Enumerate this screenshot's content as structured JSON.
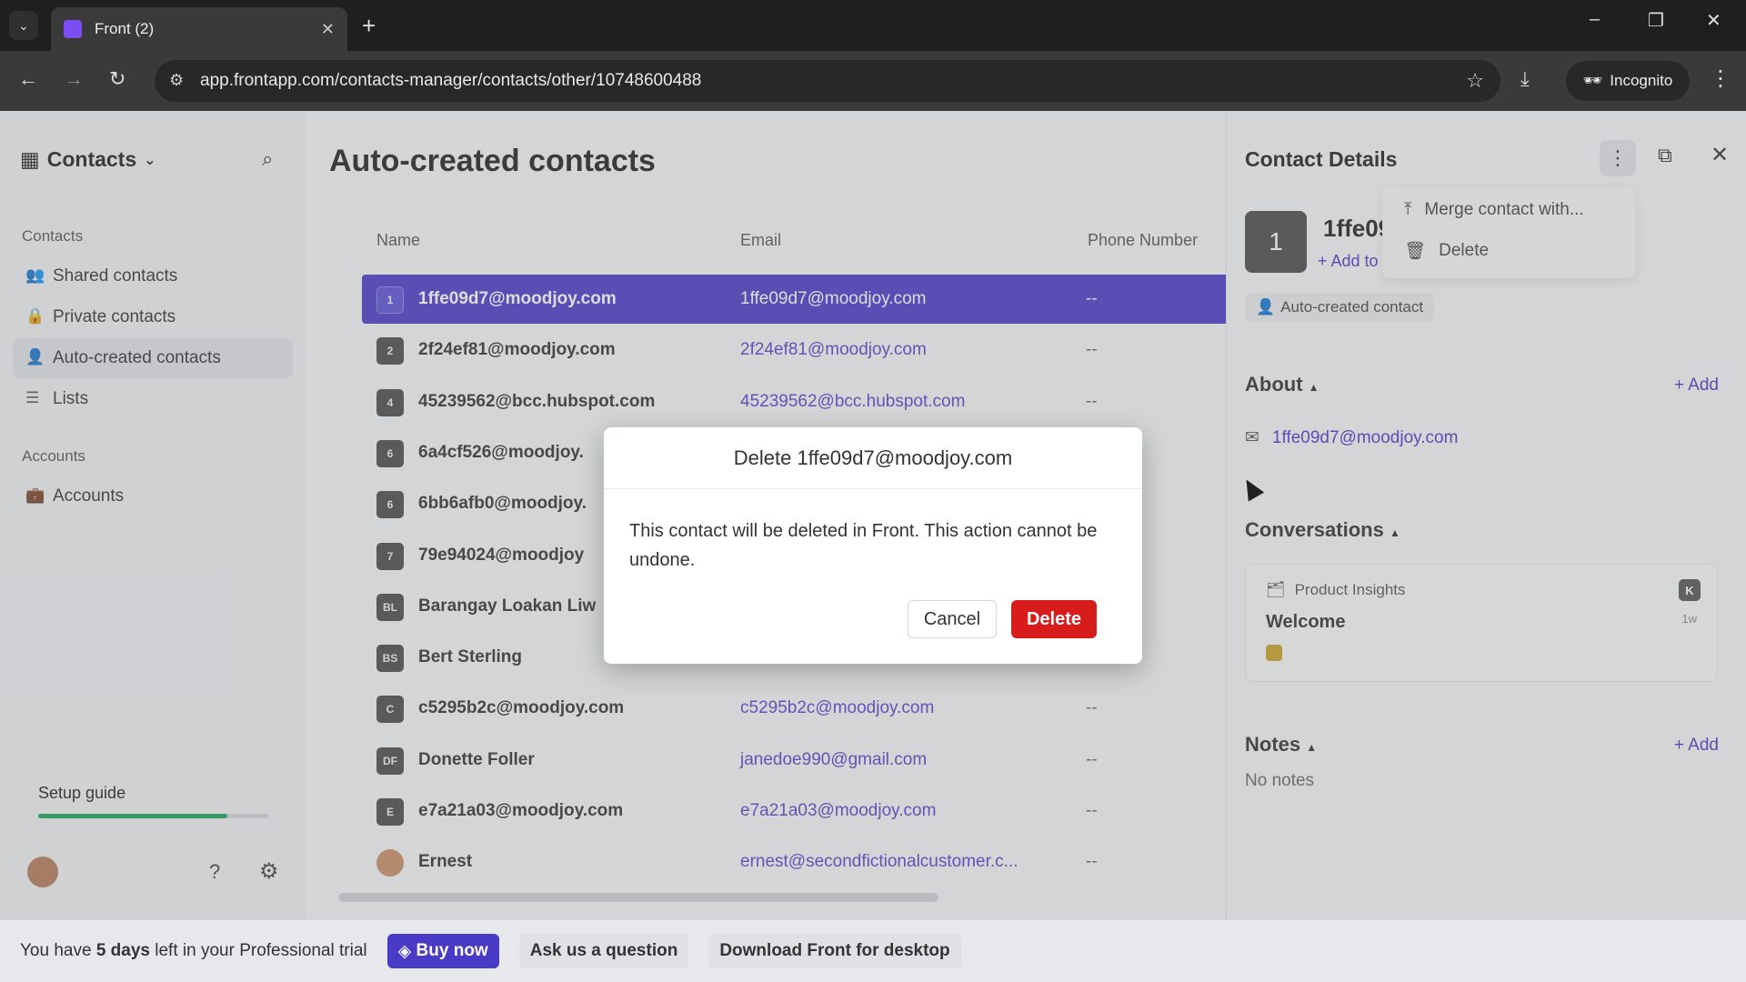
{
  "browser": {
    "tab_title": "Front (2)",
    "url": "app.frontapp.com/contacts-manager/contacts/other/10748600488",
    "incognito_label": "Incognito"
  },
  "sidebar": {
    "title": "Contacts",
    "section_contacts": "Contacts",
    "items": [
      {
        "label": "Shared contacts",
        "icon": "people-icon"
      },
      {
        "label": "Private contacts",
        "icon": "lock-icon"
      },
      {
        "label": "Auto-created contacts",
        "icon": "person-auto-icon"
      },
      {
        "label": "Lists",
        "icon": "list-icon"
      }
    ],
    "section_accounts": "Accounts",
    "accounts_item": "Accounts",
    "setup_guide": "Setup guide",
    "setup_progress": 0.82
  },
  "main": {
    "title": "Auto-created contacts",
    "columns": [
      "Name",
      "Email",
      "Phone Number"
    ],
    "rows": [
      {
        "avatar": "1",
        "name": "1ffe09d7@moodjoy.com",
        "email": "1ffe09d7@moodjoy.com",
        "phone": "--",
        "selected": true
      },
      {
        "avatar": "2",
        "name": "2f24ef81@moodjoy.com",
        "email": "2f24ef81@moodjoy.com",
        "phone": "--"
      },
      {
        "avatar": "4",
        "name": "45239562@bcc.hubspot.com",
        "email": "45239562@bcc.hubspot.com",
        "phone": "--"
      },
      {
        "avatar": "6",
        "name": "6a4cf526@moodjoy.",
        "email": "",
        "phone": ""
      },
      {
        "avatar": "6",
        "name": "6bb6afb0@moodjoy.",
        "email": "",
        "phone": ""
      },
      {
        "avatar": "7",
        "name": "79e94024@moodjoy",
        "email": "",
        "phone": ""
      },
      {
        "avatar": "BL",
        "name": "Barangay Loakan Liw",
        "email": "",
        "phone": ""
      },
      {
        "avatar": "BS",
        "name": "Bert Sterling",
        "email": "",
        "phone": ""
      },
      {
        "avatar": "C",
        "name": "c5295b2c@moodjoy.com",
        "email": "c5295b2c@moodjoy.com",
        "phone": "--"
      },
      {
        "avatar": "DF",
        "name": "Donette Foller",
        "email": "janedoe990@gmail.com",
        "phone": "--"
      },
      {
        "avatar": "E",
        "name": "e7a21a03@moodjoy.com",
        "email": "e7a21a03@moodjoy.com",
        "phone": "--"
      },
      {
        "avatar": "",
        "name": "Ernest",
        "email": "ernest@secondfictionalcustomer.c...",
        "phone": "--"
      }
    ]
  },
  "detail": {
    "title": "Contact Details",
    "avatar": "1",
    "name": "1ffe09",
    "add_to": "+ Add to",
    "badge": "Auto-created contact",
    "about": "About",
    "about_add": "+ Add",
    "email": "1ffe09d7@moodjoy.com",
    "conversations": "Conversations",
    "conv_inbox": "Product Insights",
    "conv_subject": "Welcome",
    "conv_badge": "K",
    "conv_time": "1w",
    "notes": "Notes",
    "notes_add": "+ Add",
    "no_notes": "No notes"
  },
  "menu": {
    "merge": "Merge contact with...",
    "delete": "Delete"
  },
  "modal": {
    "title": "Delete 1ffe09d7@moodjoy.com",
    "body": "This contact will be deleted in Front. This action cannot be undone.",
    "cancel": "Cancel",
    "delete": "Delete"
  },
  "banner": {
    "trial_prefix": "You have ",
    "trial_days": "5 days",
    "trial_suffix": " left in your Professional trial",
    "buy": "Buy now",
    "ask": "Ask us a question",
    "download": "Download Front for desktop"
  }
}
